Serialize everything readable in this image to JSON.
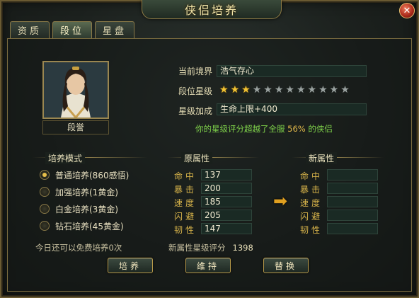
{
  "window": {
    "title": "侠侣培养"
  },
  "tabs": [
    {
      "label": "资质",
      "active": false
    },
    {
      "label": "段位",
      "active": true
    },
    {
      "label": "星盘",
      "active": false
    }
  ],
  "character": {
    "name": "段誉",
    "rank_label": "当前境界",
    "rank_value": "浩气存心",
    "star_label": "段位星级",
    "stars_filled": 3,
    "stars_total": 12,
    "bonus_label": "星级加成",
    "bonus_value": "生命上限+400",
    "notice_prefix": "你的星级评分超越了全服",
    "notice_percent": "56%",
    "notice_suffix": "的侠侣"
  },
  "modes": {
    "title": "培养模式",
    "items": [
      {
        "label": "普通培养(860感悟)",
        "selected": true
      },
      {
        "label": "加强培养(1黄金)",
        "selected": false
      },
      {
        "label": "白金培养(3黄金)",
        "selected": false
      },
      {
        "label": "钻石培养(45黄金)",
        "selected": false
      }
    ]
  },
  "attributes": {
    "old_title": "原属性",
    "new_title": "新属性",
    "labels": [
      "命中",
      "暴击",
      "速度",
      "闪避",
      "韧性"
    ],
    "old_values": [
      "137",
      "200",
      "185",
      "205",
      "147"
    ],
    "new_values": [
      "",
      "",
      "",
      "",
      ""
    ]
  },
  "footer": {
    "free_text": "今日还可以免费培养0次",
    "score_label": "新属性星级评分",
    "score_value": "1398"
  },
  "buttons": {
    "train": "培养",
    "keep": "维持",
    "replace": "替换"
  },
  "colors": {
    "star_on": "#f2c334",
    "star_off": "#9aa2a0",
    "notice_green": "#7fd24a",
    "attr_gold": "#d8b44a"
  }
}
